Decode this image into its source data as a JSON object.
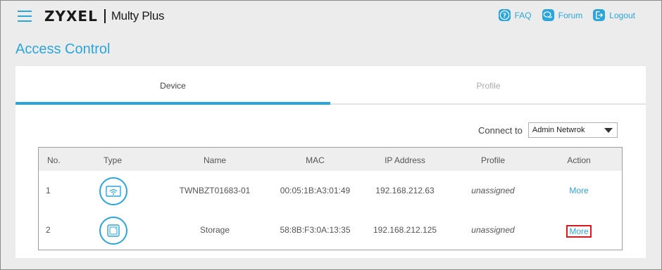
{
  "header": {
    "logo": "ZYXEL",
    "product": "Multy Plus",
    "links": [
      {
        "label": "FAQ",
        "icon": "question-icon"
      },
      {
        "label": "Forum",
        "icon": "chat-icon"
      },
      {
        "label": "Logout",
        "icon": "logout-icon"
      }
    ]
  },
  "page": {
    "title": "Access Control"
  },
  "tabs": [
    {
      "label": "Device",
      "active": true
    },
    {
      "label": "Profile",
      "active": false
    }
  ],
  "connect": {
    "label": "Connect to",
    "selected": "Admin Netwrok"
  },
  "table": {
    "headers": [
      "No.",
      "Type",
      "Name",
      "MAC",
      "IP Address",
      "Profile",
      "Action"
    ],
    "rows": [
      {
        "no": "1",
        "type_icon": "router-icon",
        "name": "TWNBZT01683-01",
        "mac": "00:05:1B:A3:01:49",
        "ip": "192.168.212.63",
        "profile": "unassigned",
        "action": "More"
      },
      {
        "no": "2",
        "type_icon": "storage-icon",
        "name": "Storage",
        "mac": "58:8B:F3:0A:13:35",
        "ip": "192.168.212.125",
        "profile": "unassigned",
        "action": "More"
      }
    ]
  },
  "colors": {
    "accent": "#2aa6dd",
    "highlight": "#d71920"
  }
}
